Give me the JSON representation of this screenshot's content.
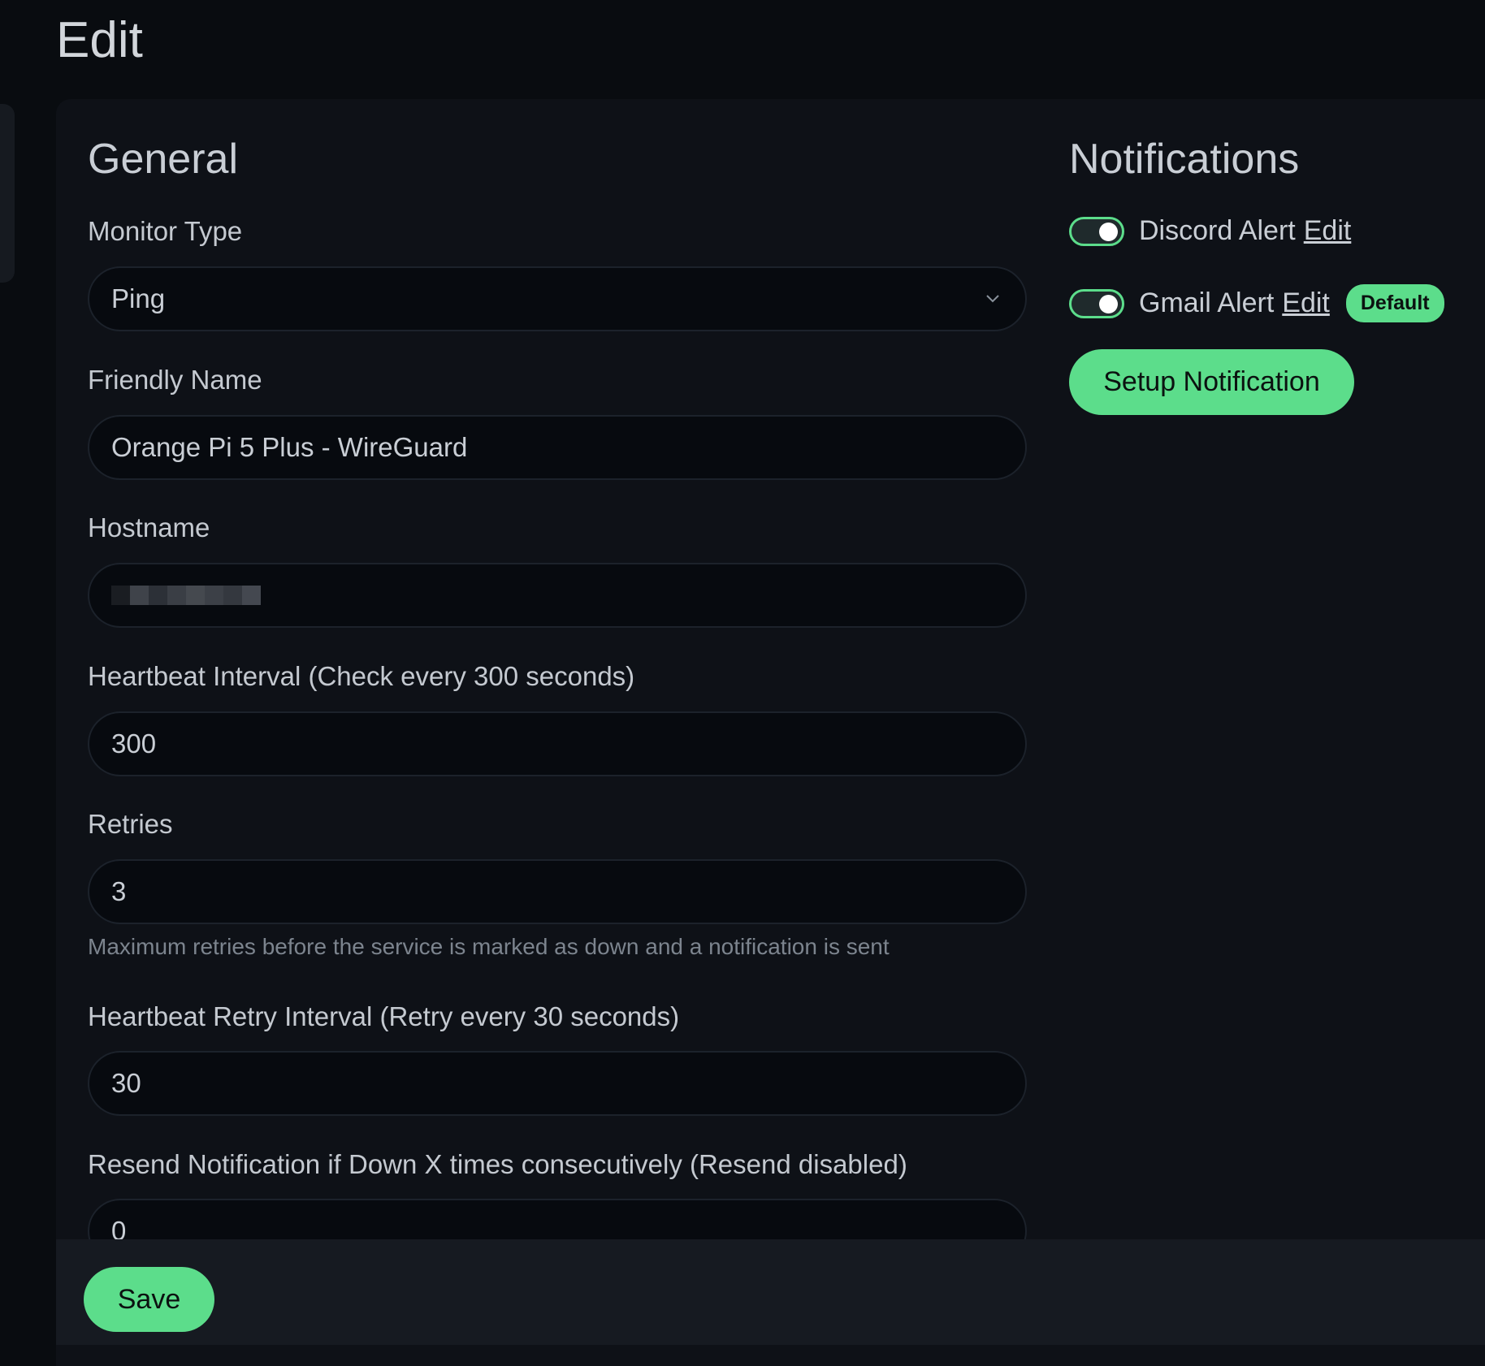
{
  "page": {
    "title": "Edit"
  },
  "general": {
    "title": "General",
    "monitor_type": {
      "label": "Monitor Type",
      "value": "Ping"
    },
    "friendly_name": {
      "label": "Friendly Name",
      "value": "Orange Pi 5 Plus - WireGuard"
    },
    "hostname": {
      "label": "Hostname",
      "value_redacted": true
    },
    "heartbeat_interval": {
      "label": "Heartbeat Interval (Check every 300 seconds)",
      "value": "300"
    },
    "retries": {
      "label": "Retries",
      "value": "3",
      "help": "Maximum retries before the service is marked as down and a notification is sent"
    },
    "retry_interval": {
      "label": "Heartbeat Retry Interval (Retry every 30 seconds)",
      "value": "30"
    },
    "resend": {
      "label": "Resend Notification if Down X times consecutively (Resend disabled)",
      "value": "0"
    }
  },
  "notifications": {
    "title": "Notifications",
    "items": [
      {
        "name": "Discord Alert",
        "edit_label": "Edit",
        "enabled": true,
        "badge": ""
      },
      {
        "name": "Gmail Alert",
        "edit_label": "Edit",
        "enabled": true,
        "badge": "Default"
      }
    ],
    "setup_label": "Setup Notification"
  },
  "footer": {
    "save_label": "Save"
  },
  "colors": {
    "accent": "#5cdd8b",
    "background": "#090c10",
    "panel": "#0e1117",
    "input": "#070a0f"
  }
}
